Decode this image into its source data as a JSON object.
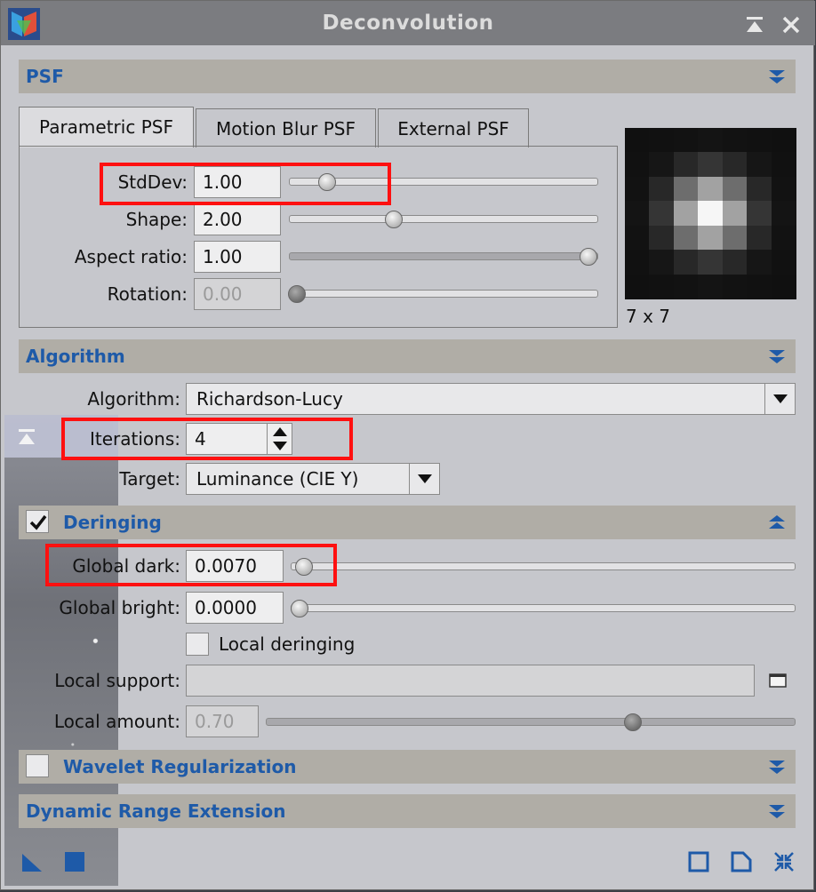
{
  "window": {
    "title": "Deconvolution"
  },
  "psf_section": {
    "title": "PSF",
    "tabs": [
      "Parametric PSF",
      "Motion Blur PSF",
      "External PSF"
    ],
    "active_tab": "Parametric PSF",
    "params": [
      {
        "label": "StdDev:",
        "value": "1.00",
        "slider_fraction": 0.12,
        "enabled": true
      },
      {
        "label": "Shape:",
        "value": "2.00",
        "slider_fraction": 0.34,
        "enabled": true
      },
      {
        "label": "Aspect ratio:",
        "value": "1.00",
        "slider_fraction": 1.0,
        "enabled": true
      },
      {
        "label": "Rotation:",
        "value": "0.00",
        "slider_fraction": 0.0,
        "enabled": false
      }
    ],
    "preview_size": "7 x 7"
  },
  "algorithm_section": {
    "title": "Algorithm",
    "algorithm_label": "Algorithm:",
    "algorithm_value": "Richardson-Lucy",
    "iterations_label": "Iterations:",
    "iterations_value": "4",
    "target_label": "Target:",
    "target_value": "Luminance (CIE Y)"
  },
  "deringing_section": {
    "title": "Deringing",
    "enabled": true,
    "global_dark_label": "Global dark:",
    "global_dark_value": "0.0070",
    "global_bright_label": "Global bright:",
    "global_bright_value": "0.0000",
    "local_deringing_label": "Local deringing",
    "local_deringing_checked": false,
    "local_support_label": "Local support:",
    "local_support_value": "",
    "local_amount_label": "Local amount:",
    "local_amount_value": "0.70",
    "local_amount_fraction": 0.7
  },
  "wavelet_section": {
    "title": "Wavelet Regularization",
    "enabled": false
  },
  "dre_section": {
    "title": "Dynamic Range Extension"
  },
  "colors": {
    "accent": "#1e5aa8",
    "highlight": "#ff1010",
    "header_bg": "#b0ada6",
    "panel_bg": "#c6c7cc"
  }
}
